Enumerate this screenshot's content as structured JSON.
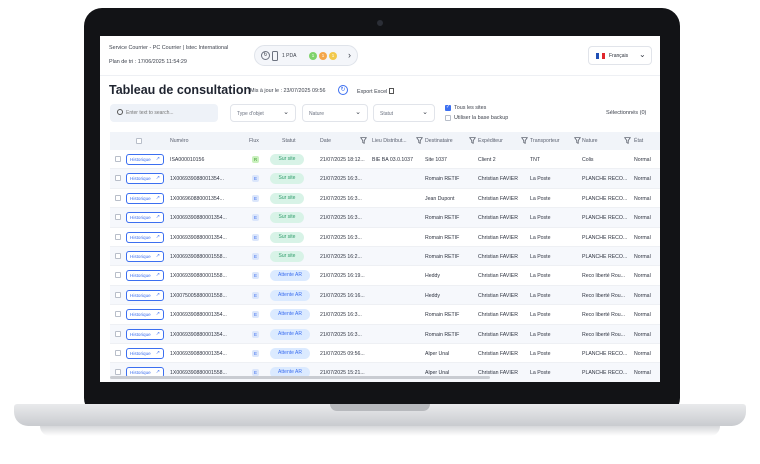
{
  "header": {
    "service": "Service Courrier - PC Courrier | Istec International",
    "plan": "Plan de tri : 17/06/2025 11:54:29",
    "pda_label": "1 PDA",
    "pda_counts": [
      "1",
      "1",
      "1"
    ],
    "pda_colors": [
      "#7fd36b",
      "#f4a64a",
      "#f2c94c"
    ],
    "language": "Français"
  },
  "title": "Tableau de consultation",
  "updated": "Mis à jour le : 23/07/2025 09:56",
  "export_label": "Export Excel",
  "filters": {
    "search_placeholder": "Enter text to search...",
    "type_objet": "Type d'objet",
    "nature": "Nature",
    "statut": "Statut",
    "tous_sites": "Tous les sites",
    "base_backup": "Utiliser la base backup",
    "selected": "Sélectionnés (0)"
  },
  "columns": [
    "Numéro",
    "Flux",
    "Statut",
    "Date",
    "Lieu Distribut...",
    "Destinataire",
    "Expéditeur",
    "Transporteur",
    "Nature",
    "État"
  ],
  "history_label": "Historique",
  "colors": {
    "accent": "#3c6ff0",
    "sur_site_bg": "#d8f3e7",
    "sur_site_fg": "#2f9c6a",
    "attente_bg": "#dbeaff",
    "attente_fg": "#3c6ff0"
  },
  "rows": [
    {
      "numero": "ISA000010156",
      "flux": "R",
      "statut": "Sur site",
      "date": "21/07/2025 18:12...",
      "lieu": "BIE BA 03.0.1037",
      "destinataire": "Site 1037",
      "expediteur": "Client 2",
      "transporteur": "TNT",
      "nature": "Colis",
      "etat": "Normal"
    },
    {
      "numero": "1X00693908800135​4...",
      "flux": "E",
      "statut": "Sur site",
      "date": "21/07/2025 16:3...",
      "lieu": "",
      "destinataire": "Romain RETIF",
      "expediteur": "Christian FAVIER",
      "transporteur": "La Poste",
      "nature": "PLANCHE RECO...",
      "etat": "Normal"
    },
    {
      "numero": "1X006960880001354...",
      "flux": "E",
      "statut": "Sur site",
      "date": "21/07/2025 16:3...",
      "lieu": "",
      "destinataire": "Jean Dupont",
      "expediteur": "Christian FAVIER",
      "transporteur": "La Poste",
      "nature": "PLANCHE RECO...",
      "etat": "Normal"
    },
    {
      "numero": "1X006939088000135​4...",
      "flux": "E",
      "statut": "Sur site",
      "date": "21/07/2025 16:3...",
      "lieu": "",
      "destinataire": "Romain RETIF",
      "expediteur": "Christian FAVIER",
      "transporteur": "La Poste",
      "nature": "PLANCHE RECO...",
      "etat": "Normal"
    },
    {
      "numero": "1X006939088000135​4...",
      "flux": "E",
      "statut": "Sur site",
      "date": "21/07/2025 16:3...",
      "lieu": "",
      "destinataire": "Romain RETIF",
      "expediteur": "Christian FAVIER",
      "transporteur": "La Poste",
      "nature": "PLANCHE RECO...",
      "etat": "Normal"
    },
    {
      "numero": "1X006939088000155​8...",
      "flux": "E",
      "statut": "Sur site",
      "date": "21/07/2025 16:2...",
      "lieu": "",
      "destinataire": "Romain RETIF",
      "expediteur": "Christian FAVIER",
      "transporteur": "La Poste",
      "nature": "PLANCHE RECO...",
      "etat": "Normal"
    },
    {
      "numero": "1X006939088000155​8...",
      "flux": "E",
      "statut": "Attente AR",
      "date": "21/07/2025 16:19...",
      "lieu": "",
      "destinataire": "Heddy",
      "expediteur": "Christian FAVIER",
      "transporteur": "La Poste",
      "nature": "Reco liberté Rou...",
      "etat": "Normal"
    },
    {
      "numero": "1X007500588000155​8...",
      "flux": "E",
      "statut": "Attente AR",
      "date": "21/07/2025 16:16...",
      "lieu": "",
      "destinataire": "Heddy",
      "expediteur": "Christian FAVIER",
      "transporteur": "La Poste",
      "nature": "Reco liberté Rou...",
      "etat": "Normal"
    },
    {
      "numero": "1X006939088000135​4...",
      "flux": "E",
      "statut": "Attente AR",
      "date": "21/07/2025 16:3...",
      "lieu": "",
      "destinataire": "Romain RETIF",
      "expediteur": "Christian FAVIER",
      "transporteur": "La Poste",
      "nature": "Reco liberté Rou...",
      "etat": "Normal"
    },
    {
      "numero": "1X006939088000135​4...",
      "flux": "E",
      "statut": "Attente AR",
      "date": "21/07/2025 16:3...",
      "lieu": "",
      "destinataire": "Romain RETIF",
      "expediteur": "Christian FAVIER",
      "transporteur": "La Poste",
      "nature": "Reco liberté Rou...",
      "etat": "Normal"
    },
    {
      "numero": "1X006939088000135​4...",
      "flux": "E",
      "statut": "Attente AR",
      "date": "21/07/2025 09:56...",
      "lieu": "",
      "destinataire": "Alper Unal",
      "expediteur": "Christian FAVIER",
      "transporteur": "La Poste",
      "nature": "PLANCHE RECO...",
      "etat": "Normal"
    },
    {
      "numero": "1X006939088000155​8...",
      "flux": "E",
      "statut": "Attente AR",
      "date": "21/07/2025 15:21...",
      "lieu": "",
      "destinataire": "Alper Unal",
      "expediteur": "Christian FAVIER",
      "transporteur": "La Poste",
      "nature": "PLANCHE RECO...",
      "etat": "Normal"
    }
  ]
}
